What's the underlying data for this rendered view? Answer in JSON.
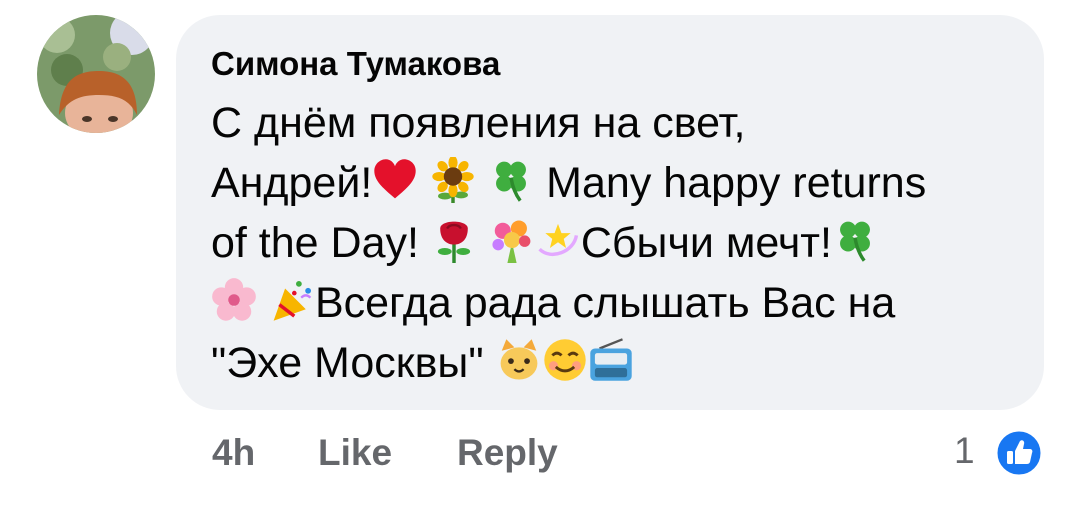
{
  "comment": {
    "author": "Симона Тумакова",
    "lines": [
      {
        "pre": "С днём появления на свет,",
        "post": ""
      },
      {
        "pre": "Андрей!",
        "post": " Many happy returns"
      },
      {
        "pre": "of the Day! ",
        "post": "Сбычи мечт!"
      },
      {
        "pre": "",
        "post": "Всегда рада слышать Вас на"
      },
      {
        "pre": "\"Эхе Москвы\" ",
        "post": ""
      }
    ],
    "emoji": {
      "line2": [
        "heart-icon",
        "sunflower-icon",
        "four-leaf-clover-icon"
      ],
      "line3": [
        "rose-icon",
        "bouquet-icon",
        "dizzy-icon",
        "four-leaf-clover-icon"
      ],
      "line4": [
        "cherry-blossom-icon",
        "party-popper-icon"
      ],
      "line5": [
        "cat-face-icon",
        "smiling-face-icon",
        "radio-icon"
      ]
    }
  },
  "actions": {
    "time": "4h",
    "like": "Like",
    "reply": "Reply",
    "reaction_count": "1"
  },
  "colors": {
    "bubble": "#f0f2f5",
    "text": "#050505",
    "meta": "#65676b",
    "like_blue": "#1877f2"
  }
}
